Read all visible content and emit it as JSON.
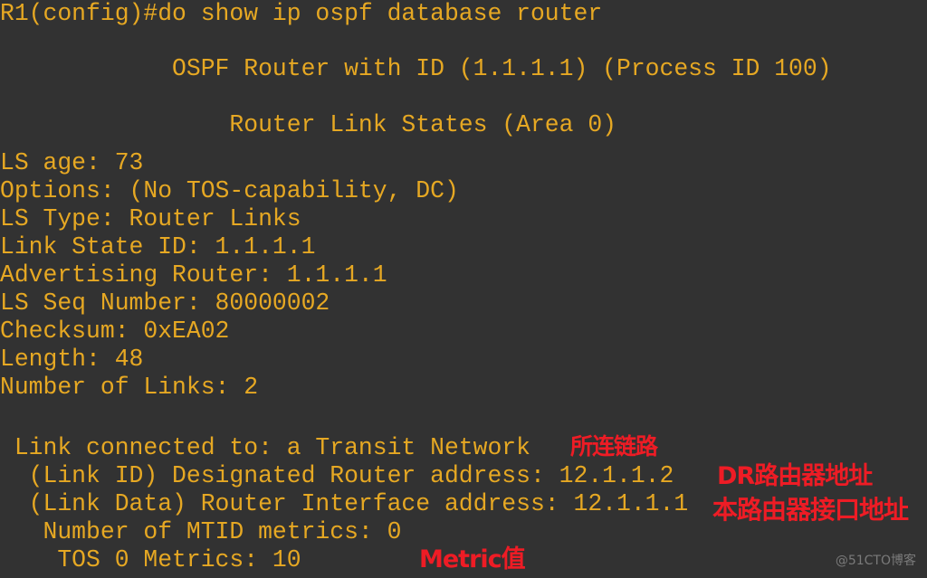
{
  "terminal": {
    "command_line": "R1(config)#do show ip ospf database router",
    "header_router_id": "            OSPF Router with ID (1.1.1.1) (Process ID 100)",
    "header_area": "                Router Link States (Area 0)",
    "fields": [
      "LS age: 73",
      "Options: (No TOS-capability, DC)",
      "LS Type: Router Links",
      "Link State ID: 1.1.1.1",
      "Advertising Router: 1.1.1.1",
      "LS Seq Number: 80000002",
      "Checksum: 0xEA02",
      "Length: 48",
      "Number of Links: 2"
    ],
    "link": {
      "connected_to": " Link connected to: a Transit Network",
      "link_id": "  (Link ID) Designated Router address: 12.1.1.2",
      "link_data": "  (Link Data) Router Interface address: 12.1.1.1",
      "mtid_metrics": "   Number of MTID metrics: 0",
      "tos_metrics": "    TOS 0 Metrics: 10"
    }
  },
  "annotations": {
    "connected_link": "所连链路",
    "dr_address": "DR路由器地址",
    "interface_address": "本路由器接口地址",
    "metric_value": "Metric值"
  },
  "watermark": "@51CTO博客",
  "colors": {
    "background": "#323232",
    "terminal_text": "#e6a823",
    "annotation": "#ee1c25",
    "watermark": "#7a7a7a"
  }
}
